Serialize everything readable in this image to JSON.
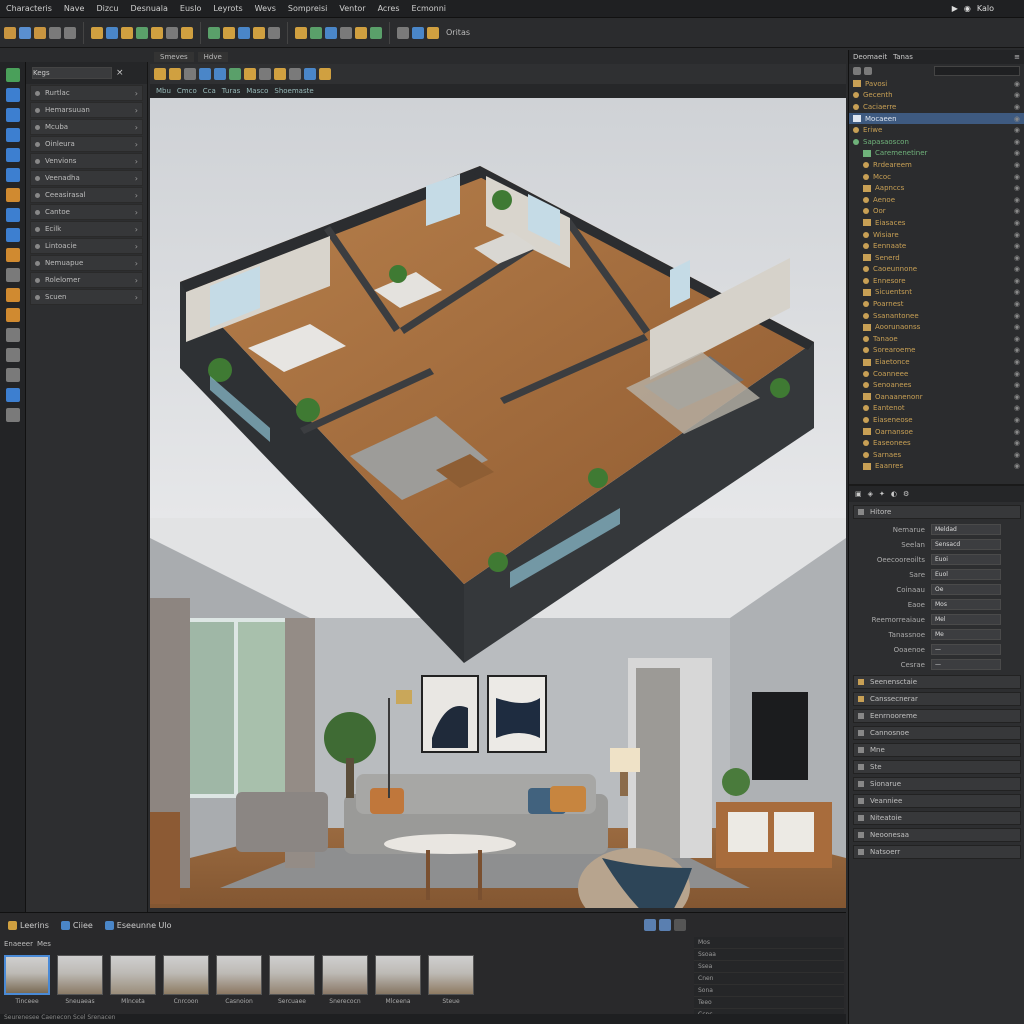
{
  "menu": {
    "items": [
      "Characteris",
      "Nave",
      "Dizcu",
      "Desnuala",
      "Euslo",
      "Leyrots",
      "Wevs",
      "Sompreisi",
      "Ventor",
      "Acres",
      "Ecmonni"
    ],
    "right_label": "Kalo"
  },
  "toolbar": {
    "label": "Oritas"
  },
  "layers": {
    "search_value": "Kegs",
    "items": [
      "Rurtlac",
      "Hemarsuuan",
      "Mcuba",
      "Oinleura",
      "Venvions",
      "Veenadha",
      "Ceeasirasal",
      "Cantoe",
      "Ecilk",
      "Lintoacie",
      "Nemuapue",
      "Rolelomer",
      "Scuen"
    ]
  },
  "viewport": {
    "tabs": [
      "Smeves",
      "Hdve"
    ],
    "subtabs": [
      "Mbu",
      "Cmco",
      "Cca",
      "Turas",
      "Masco",
      "Shoemaste"
    ]
  },
  "outliner": {
    "header_items": [
      "Deomaeit",
      "Tanas"
    ],
    "rows": [
      {
        "label": "Pavosi",
        "color": "#c8a055"
      },
      {
        "label": "Gecenth",
        "color": "#c8a055"
      },
      {
        "label": "Caciaerre",
        "color": "#c8a055"
      },
      {
        "label": "Mocaeen",
        "color": "#dfe6f0"
      },
      {
        "label": "Eriwe",
        "color": "#c8a055"
      },
      {
        "label": "Sapasaoscon",
        "color": "#6fb27a"
      },
      {
        "label": "Caremenetiner",
        "color": "#6fb27a"
      },
      {
        "label": "Rrdeareem",
        "color": "#c8a055"
      },
      {
        "label": "Mcoc",
        "color": "#c8a055"
      },
      {
        "label": "Aapnccs",
        "color": "#c8a055"
      },
      {
        "label": "Aenoe",
        "color": "#c8a055"
      },
      {
        "label": "Oor",
        "color": "#c8a055"
      },
      {
        "label": "Eiasaces",
        "color": "#c8a055"
      },
      {
        "label": "Wisiare",
        "color": "#c8a055"
      },
      {
        "label": "Eennaate",
        "color": "#c8a055"
      },
      {
        "label": "Senerd",
        "color": "#c8a055"
      },
      {
        "label": "Caoeunnone",
        "color": "#c8a055"
      },
      {
        "label": "Ennesore",
        "color": "#c8a055"
      },
      {
        "label": "Sicuentsnt",
        "color": "#c8a055"
      },
      {
        "label": "Poarnest",
        "color": "#c8a055"
      },
      {
        "label": "Ssanantonee",
        "color": "#c8a055"
      },
      {
        "label": "Aoorunaonss",
        "color": "#c8a055"
      },
      {
        "label": "Tanaoe",
        "color": "#c8a055"
      },
      {
        "label": "Sorearoeme",
        "color": "#c8a055"
      },
      {
        "label": "Eiaetonce",
        "color": "#c8a055"
      },
      {
        "label": "Coanneee",
        "color": "#c8a055"
      },
      {
        "label": "Senoanees",
        "color": "#c8a055"
      },
      {
        "label": "Oanaanenonr",
        "color": "#c8a055"
      },
      {
        "label": "Eantenot",
        "color": "#c8a055"
      },
      {
        "label": "Eiaseneose",
        "color": "#c8a055"
      },
      {
        "label": "Oarnansoe",
        "color": "#c8a055"
      },
      {
        "label": "Easeonees",
        "color": "#c8a055"
      },
      {
        "label": "Sarnaes",
        "color": "#c8a055"
      },
      {
        "label": "Eaanres",
        "color": "#c8a055"
      }
    ]
  },
  "properties": {
    "header": "Hitore",
    "fields": [
      {
        "label": "Nemarue",
        "value": "Meldad"
      },
      {
        "label": "Seelan",
        "value": "Sensacd"
      },
      {
        "label": "Oeecooreoilts",
        "value": "Euoi"
      },
      {
        "label": "Sare",
        "value": "Euol"
      },
      {
        "label": "Coinaau",
        "value": "Oe"
      },
      {
        "label": "Eaoe",
        "value": "Mos"
      },
      {
        "label": "Reemorreaiaue",
        "value": "Mel"
      },
      {
        "label": "Tanassnoe",
        "value": "Me"
      },
      {
        "label": "Ooaenoe",
        "value": "—"
      },
      {
        "label": "Cesrae",
        "value": "—"
      }
    ],
    "sections": [
      "Seenensctaie",
      "Canssecnerar",
      "Eenrnooreme",
      "Cannosnoe",
      "Mne",
      "Ste",
      "Sionarue",
      "Veanniee",
      "Niteatoie",
      "Neoonesaa",
      "Natsoerr"
    ]
  },
  "bottom": {
    "tabs": [
      "Leerins",
      "Ciiee",
      "Eseeunne Ulo"
    ],
    "sub": [
      "Enaeeer",
      "Mes"
    ],
    "thumbs": [
      "Tinceee",
      "Sneuaeas",
      "Mlnceta",
      "Cnrcoon",
      "Casnoion",
      "Sercuaee",
      "Snerecocn",
      "Mlceena",
      "Steue"
    ],
    "timeline": [
      "Mos",
      "Ssoaa",
      "Ssea",
      "Cnen",
      "Sona",
      "Teeo",
      "Ccnc"
    ],
    "status": "Seurenesee Caenecon Scel Srenacen"
  }
}
